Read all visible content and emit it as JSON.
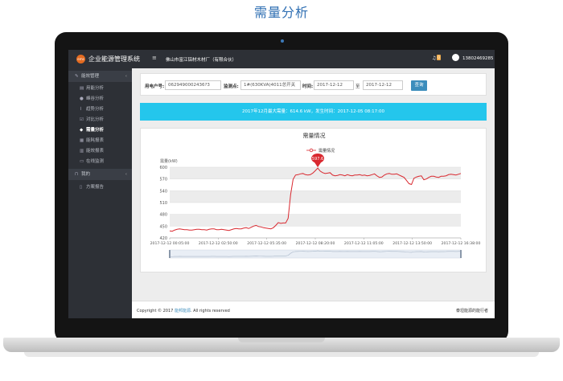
{
  "page_title": "需量分析",
  "app": {
    "title": "企业能源管理系统",
    "logo_text": "ems",
    "company": "佛山市富江铝材木材厂（有限合伙）",
    "notification_count": "0",
    "user_id": "13802469285"
  },
  "sidebar": {
    "groups": [
      {
        "label": "能效管理"
      },
      {
        "label": "我的"
      }
    ],
    "items": [
      {
        "label": "用能分析",
        "icon": "bar-chart-icon"
      },
      {
        "label": "峰谷分析",
        "icon": "pie-chart-icon"
      },
      {
        "label": "趋势分析",
        "icon": "line-chart-icon"
      },
      {
        "label": "对比分析",
        "icon": "check-square-icon"
      },
      {
        "label": "需量分析",
        "icon": "diamond-icon",
        "active": true
      },
      {
        "label": "能耗报表",
        "icon": "calendar-icon"
      },
      {
        "label": "能效报表",
        "icon": "table-icon"
      },
      {
        "label": "在线监测",
        "icon": "monitor-icon"
      },
      {
        "label": "方案报告",
        "icon": "file-icon"
      }
    ]
  },
  "filter": {
    "account_label": "用电户号:",
    "account_value": "0629490002436?3",
    "monitor_label": "监测点:",
    "monitor_value": "1#(630KVA)4011总开关",
    "time_label": "时间:",
    "date_from": "2017-12-12",
    "to_label": "至",
    "date_to": "2017-12-12",
    "query_label": "查询"
  },
  "banner": {
    "text": "2017年12月最大需量：614.6 kW，发生时间：2017-12-05 08:17:00"
  },
  "chart_data": {
    "type": "line",
    "title": "需量情况",
    "ylabel": "需量(kW)",
    "ylim": [
      420,
      600
    ],
    "yticks": [
      420,
      450,
      480,
      510,
      540,
      570,
      600
    ],
    "series": [
      {
        "name": "需量情况",
        "color": "#d9282f",
        "values": [
          438,
          437,
          440,
          442,
          443,
          442,
          441,
          441,
          440,
          440,
          441,
          442,
          442,
          441,
          441,
          440,
          442,
          443,
          443,
          441,
          441,
          442,
          441,
          440,
          439,
          441,
          443,
          444,
          443,
          443,
          445,
          446,
          444,
          447,
          450,
          452,
          449,
          448,
          446,
          445,
          444,
          443,
          446,
          452,
          459,
          457,
          458,
          458,
          470,
          530,
          569,
          580,
          581,
          583,
          584,
          581,
          580,
          581,
          585,
          591,
          597.6,
          590,
          586,
          584,
          585,
          586,
          580,
          578,
          579,
          581,
          580,
          578,
          581,
          579,
          578,
          580,
          580,
          581,
          579,
          580,
          578,
          579,
          581,
          583,
          578,
          574,
          575,
          580,
          583,
          584,
          582,
          582,
          583,
          580,
          577,
          574,
          566,
          558,
          556,
          572,
          575,
          577,
          578,
          568,
          570,
          574,
          577,
          577,
          575,
          574,
          577,
          577,
          578,
          581,
          582,
          581,
          580,
          582,
          584
        ]
      }
    ],
    "x_tick_labels": [
      "2017-12-12 00:05:00",
      "2017-12-12 02:50:00",
      "2017-12-12 05:35:00",
      "2017-12-12 08:20:00",
      "2017-12-12 11:05:00",
      "2017-12-12 13:50:00",
      "2017-12-12 16:38:00"
    ],
    "marker": {
      "label": "597.6",
      "value": 597.6,
      "index": 60,
      "color": "#d9282f"
    },
    "grid": true,
    "legend": "top-center"
  },
  "footer": {
    "copyright_prefix": "Copyright © 2017",
    "copyright_link": "能邦能源",
    "copyright_suffix": ". All rights reserved",
    "right_text": "泰坦能源的能行者"
  }
}
